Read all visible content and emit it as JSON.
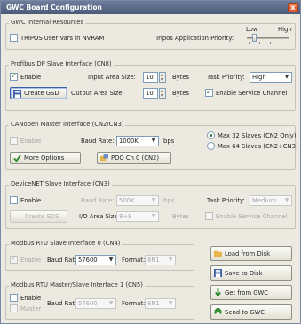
{
  "window": {
    "title": "GWC Board Configuration",
    "close": "x"
  },
  "internal": {
    "title": "GWC Internal Resources",
    "tripos_vars": "TRIPOS User Vars in NVRAM",
    "priority_label": "Tripos Application Priority:",
    "low": "Low",
    "high": "High",
    "priority_level": 0.15
  },
  "profibus": {
    "title": "Profibus DP Slave Interface (CN8)",
    "enable": "Enable",
    "input_label": "Input Area Size:",
    "input_value": "10",
    "output_label": "Output Area Size:",
    "output_value": "10",
    "bytes": "Bytes",
    "task_priority_label": "Task Priority:",
    "task_priority_value": "High",
    "create_gsd": "Create GSD",
    "service_channel": "Enable Service Channel"
  },
  "canopen": {
    "title": "CANopen Master Interface (CN2/CN3)",
    "enable": "Enable",
    "baud_label": "Baud Rate:",
    "baud_value": "1000K",
    "bps": "bps",
    "max32": "Max 32 Slaves (CN2 Only)",
    "max64": "Max 64 Slaves (CN2+CN3)",
    "more_options": "More Options",
    "pdo": "PDO Ch 0 (CN2)"
  },
  "devicenet": {
    "title": "DeviceNET Slave Interface (CN3)",
    "enable": "Enable",
    "baud_label": "Baud Rate:",
    "baud_value": "500K",
    "bps": "bps",
    "task_priority_label": "Task Priority:",
    "task_priority_value": "Medium",
    "create_eds": "Create EDS",
    "io_label": "I/O Area Size:",
    "io_value": "8+8",
    "bytes": "Bytes",
    "service_channel": "Enable Service Channel"
  },
  "modbus0": {
    "title": "Modbus RTU Slave Interface 0 (CN4)",
    "enable": "Enable",
    "baud_label": "Baud Rate:",
    "baud_value": "57600",
    "format_label": "Format:",
    "format_value": "8N1"
  },
  "modbus1": {
    "title": "Modbus RTU Master/Slave Interface 1 (CN5)",
    "enable": "Enable",
    "master": "Master",
    "baud_label": "Baud Rate:",
    "baud_value": "57600",
    "format_label": "Format:",
    "format_value": "8N1"
  },
  "actions": {
    "load": "Load from Disk",
    "save": "Save to Disk",
    "get": "Get from GWC",
    "send": "Send to GWC"
  },
  "colors": {
    "accent": "#3a5fa6",
    "check": "#2a7a2a",
    "title_bar": "#4a5a78",
    "close": "#d8542a"
  }
}
